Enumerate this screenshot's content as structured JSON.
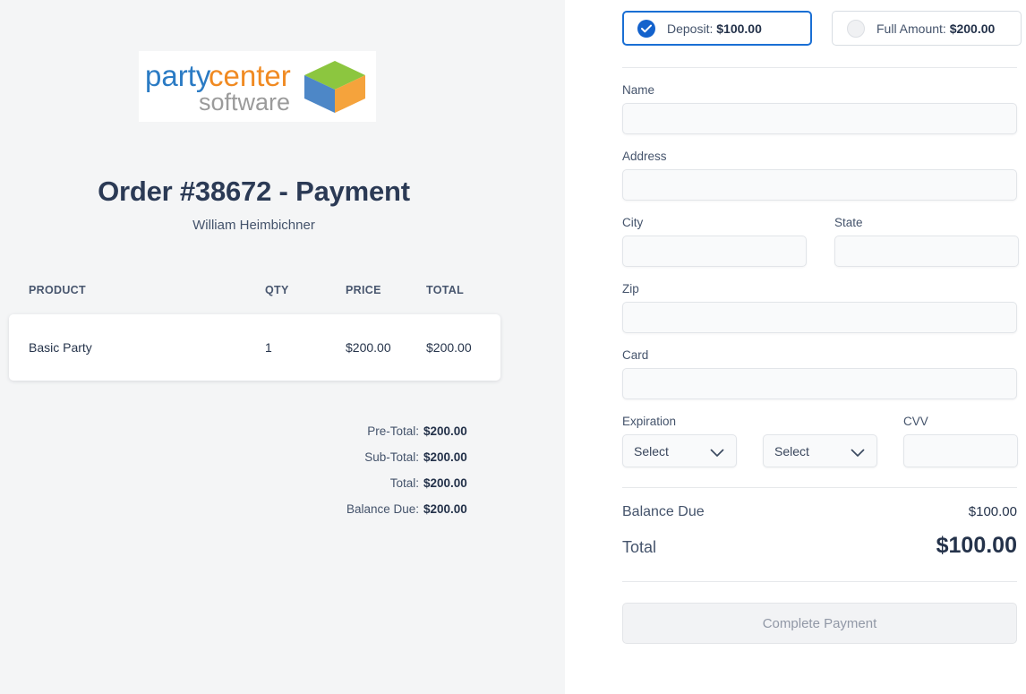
{
  "left": {
    "logo": {
      "name": "partycenter-software-logo",
      "word1a": "party",
      "word1b": "center",
      "word2": "software"
    },
    "title": "Order #38672 - Payment",
    "customer": "William Heimbichner",
    "table": {
      "columns": [
        "PRODUCT",
        "QTY",
        "PRICE",
        "TOTAL"
      ],
      "rows": [
        {
          "product": "Basic Party",
          "qty": "1",
          "price": "$200.00",
          "total": "$200.00"
        }
      ]
    },
    "totals": [
      {
        "label": "Pre-Total:",
        "value": "$200.00"
      },
      {
        "label": "Sub-Total:",
        "value": "$200.00"
      },
      {
        "label": "Total:",
        "value": "$200.00"
      },
      {
        "label": "Balance Due:",
        "value": "$200.00"
      }
    ]
  },
  "right": {
    "payment_options": [
      {
        "label": "Deposit: ",
        "amount": "$100.00",
        "selected": true
      },
      {
        "label": "Full Amount: ",
        "amount": "$200.00",
        "selected": false
      }
    ],
    "fields": {
      "name_label": "Name",
      "name_value": "",
      "name_placeholder": "",
      "address_label": "Address",
      "address_value": "",
      "address_placeholder": "",
      "city_label": "City",
      "city_value": "",
      "city_placeholder": "",
      "state_label": "State",
      "state_value": "",
      "state_placeholder": "",
      "zip_label": "Zip",
      "zip_value": "",
      "zip_placeholder": "",
      "card_label": "Card",
      "card_value": "",
      "card_placeholder": "",
      "expiration_label": "Expiration",
      "expiration_month": "Select",
      "expiration_year": "Select",
      "cvv_label": "CVV",
      "cvv_value": "",
      "cvv_placeholder": ""
    },
    "summary": {
      "balance_label": "Balance Due",
      "balance_value": "$100.00",
      "total_label": "Total",
      "total_value": "$100.00"
    },
    "submit_label": "Complete Payment"
  },
  "colors": {
    "accent_blue": "#1362cc",
    "selected_border": "#1a6fd4",
    "panel_bg": "#f4f5f6",
    "text_dark": "#24324a",
    "text_muted": "#44536b"
  }
}
